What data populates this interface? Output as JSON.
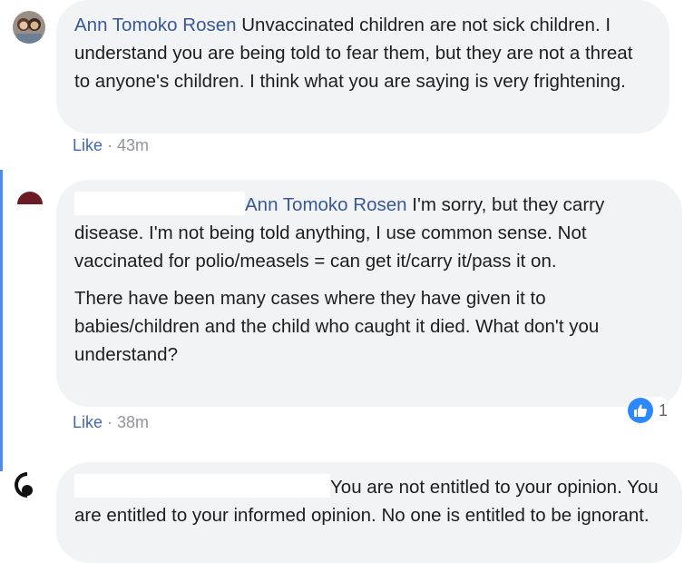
{
  "comments": [
    {
      "author": "Ann Tomoko Rosen",
      "text": " Unvaccinated children are not sick children. I understand you are being told to fear them, but they are not a threat to anyone's children. I think what you are saying is very frightening.",
      "like_label": "Like",
      "separator": " · ",
      "time": "43m"
    },
    {
      "mention": "Ann Tomoko Rosen",
      "text": " I'm sorry, but they carry disease. I'm not being told anything, I use common sense. Not vaccinated for polio/measels = can get it/carry it/pass it on.",
      "text2": "There have been many cases where they have given it to babies/children and the child who caught it died. What don't you understand?",
      "like_label": "Like",
      "separator": " · ",
      "time": "38m",
      "reaction_count": "1",
      "reaction_icon": "thumbs-up-icon",
      "reaction_color": "#2d88ff"
    },
    {
      "text": "You are not entitled to your opinion. You are entitled to your informed opinion. No one is entitled to be ignorant."
    }
  ]
}
